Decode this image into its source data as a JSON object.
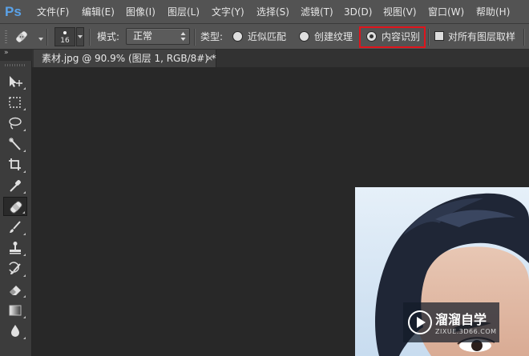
{
  "app": {
    "logo": "Ps"
  },
  "menu": [
    {
      "label": "文件(F)"
    },
    {
      "label": "编辑(E)"
    },
    {
      "label": "图像(I)"
    },
    {
      "label": "图层(L)"
    },
    {
      "label": "文字(Y)"
    },
    {
      "label": "选择(S)"
    },
    {
      "label": "滤镜(T)"
    },
    {
      "label": "3D(D)"
    },
    {
      "label": "视图(V)"
    },
    {
      "label": "窗口(W)"
    },
    {
      "label": "帮助(H)"
    }
  ],
  "options": {
    "tool_icon": "spot-healing-brush-icon",
    "brush_size": "16",
    "mode_label": "模式:",
    "mode_value": "正常",
    "type_label": "类型:",
    "types": [
      {
        "label": "近似匹配",
        "checked": false
      },
      {
        "label": "创建纹理",
        "checked": false
      },
      {
        "label": "内容识别",
        "checked": true
      }
    ],
    "sample_all_label": "对所有图层取样",
    "highlight_color": "#e0141c"
  },
  "document": {
    "tab_title": "素材.jpg @ 90.9% (图层 1, RGB/8#) *",
    "close_glyph": "×"
  },
  "toolbox": {
    "collapse_glyph": "»",
    "tools": [
      {
        "name": "move-tool-icon"
      },
      {
        "name": "rectangular-marquee-tool-icon"
      },
      {
        "name": "lasso-tool-icon"
      },
      {
        "name": "magic-wand-tool-icon"
      },
      {
        "name": "crop-tool-icon"
      },
      {
        "name": "eyedropper-tool-icon"
      },
      {
        "name": "spot-healing-brush-tool-icon",
        "active": true
      },
      {
        "name": "brush-tool-icon"
      },
      {
        "name": "clone-stamp-tool-icon"
      },
      {
        "name": "history-brush-tool-icon"
      },
      {
        "name": "eraser-tool-icon"
      },
      {
        "name": "gradient-tool-icon"
      },
      {
        "name": "blur-tool-icon"
      }
    ]
  },
  "watermark": {
    "title": "溜溜自学",
    "url": "ZIXUE.3D66.COM"
  },
  "colors": {
    "ui_panel": "#535353",
    "canvas_bg": "#282828",
    "accent_ps": "#5aa2e8"
  }
}
